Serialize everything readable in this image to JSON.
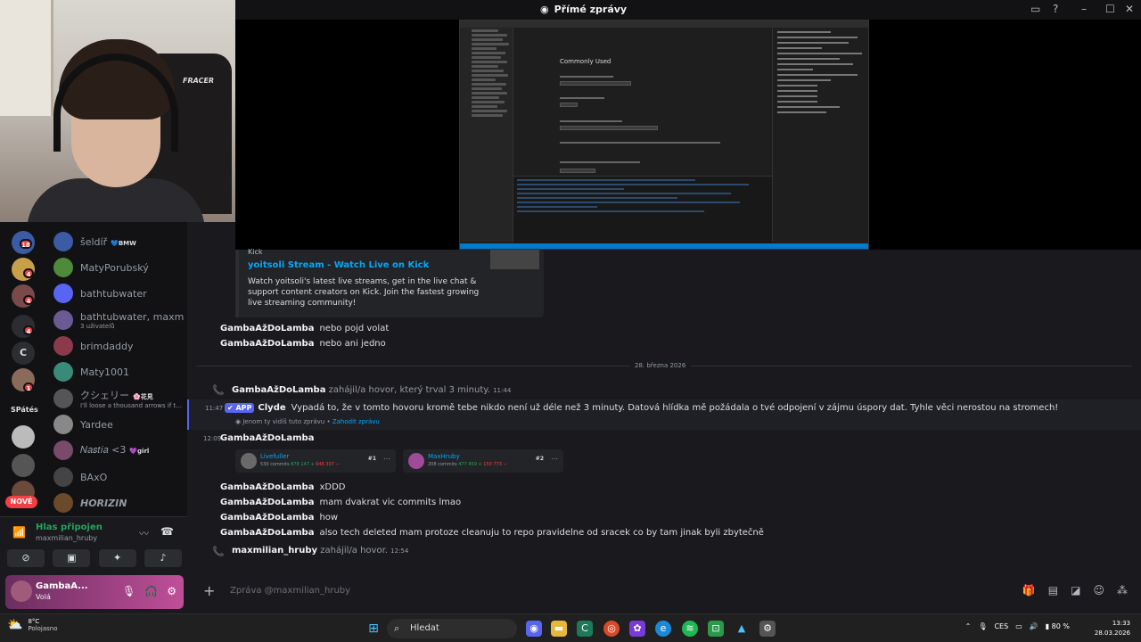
{
  "window": {
    "title": "Přímé zprávy",
    "discord_icon": "discord-logo-icon"
  },
  "webcam": {
    "chair_brand": "FRACER"
  },
  "rail": {
    "badges": [
      "18",
      "4",
      "4",
      "4",
      "1"
    ],
    "server_letter": "C",
    "server_text": "SPátés",
    "new_label": "NOVÉ"
  },
  "dms": [
    {
      "name": "šeldíř",
      "tag": "💙BMW",
      "color": "#3b5ba5"
    },
    {
      "name": "MatyPorubský",
      "tag": "",
      "color": "#4e8a3a"
    },
    {
      "name": "bathtubwater",
      "tag": "",
      "color": "#5865f2"
    },
    {
      "name": "bathtubwater, maxmili...",
      "sub": "3 uživatelů",
      "color": "#6b5b95"
    },
    {
      "name": "brimdaddy",
      "tag": "",
      "color": "#8a3a4a"
    },
    {
      "name": "Maty1001",
      "tag": "",
      "color": "#3a8a7a"
    },
    {
      "name": "クシェリー",
      "tag": "🌸花見",
      "sub": "I'll loose a thousand arrows if t...",
      "color": "#555"
    },
    {
      "name": "Yardee",
      "tag": "",
      "color": "#888"
    },
    {
      "name": "𝑁𝑎𝑠𝑡𝑖𝑎 <3",
      "tag": "💜girl",
      "color": "#7a4a6a"
    },
    {
      "name": "BAxO",
      "tag": "",
      "color": "#444"
    },
    {
      "name": "HORIZIN",
      "tag": "",
      "color": "#6a4a2a"
    }
  ],
  "voice": {
    "status": "Hlas připojen",
    "channel": "maxmilian_hruby"
  },
  "user": {
    "name": "GambaA...",
    "status": "Volá"
  },
  "chat": {
    "embed": {
      "provider": "Kick",
      "title": "yoitsoli Stream - Watch Live on Kick",
      "description": "Watch yoitsoli's latest live streams, get in the live chat & support content creators on Kick. Join the fastest growing live streaming community!"
    },
    "messages_top": [
      {
        "author": "GambaAžDoLamba",
        "text": "nebo pojd volat"
      },
      {
        "author": "GambaAžDoLamba",
        "text": "nebo ani jedno"
      }
    ],
    "date_divider": "28. března 2026",
    "call1": {
      "author": "GambaAžDoLamba",
      "text": "zahájil/a hovor, který trval 3 minuty.",
      "time": "11:44"
    },
    "app_msg": {
      "time": "11:47",
      "badge": "✔ APP",
      "author": "Clyde",
      "text": "Vypadá to, že v tomto hovoru kromě tebe nikdo není už déle než 3 minuty. Datová hlídka mě požádala o tvé odpojení v zájmu úspory dat. Tyhle věci nerostou na stromech!",
      "ephemeral": "Jenom ty vidíš tuto zprávu •",
      "dismiss": "Zahodit zprávu"
    },
    "msg_1209": {
      "time": "12:09",
      "author": "GambaAžDoLamba"
    },
    "cards": [
      {
        "name": "Livefuller",
        "stats_plain": "530 commits",
        "add": "878 147 +",
        "del": "646 307 −",
        "rank": "#1"
      },
      {
        "name": "MaxHruby",
        "stats_plain": "208 commits",
        "add": "477 459 +",
        "del": "150 773 −",
        "rank": "#2"
      }
    ],
    "messages_bottom": [
      {
        "author": "GambaAžDoLamba",
        "text": "xDDD"
      },
      {
        "author": "GambaAžDoLamba",
        "text": "mam dvakrat vic commits lmao"
      },
      {
        "author": "GambaAžDoLamba",
        "text": "how"
      },
      {
        "author": "GambaAžDoLamba",
        "text": "also tech deleted mam protoze cleanuju to repo pravidelne od sracek co by tam jinak byli zbytečně"
      }
    ],
    "call2": {
      "author": "maxmilian_hruby",
      "text": "zahájil/a hovor.",
      "time": "12:54"
    }
  },
  "composer": {
    "placeholder": "Zpráva @maxmilian_hruby"
  },
  "vscode": {
    "settings_heading": "Commonly Used"
  },
  "taskbar": {
    "weather_temp": "8°C",
    "weather_desc": "Polojasno",
    "search_label": "Hledat",
    "lang": "CES",
    "battery": "80 %",
    "time": "13:33",
    "date": "28.03.2026"
  }
}
